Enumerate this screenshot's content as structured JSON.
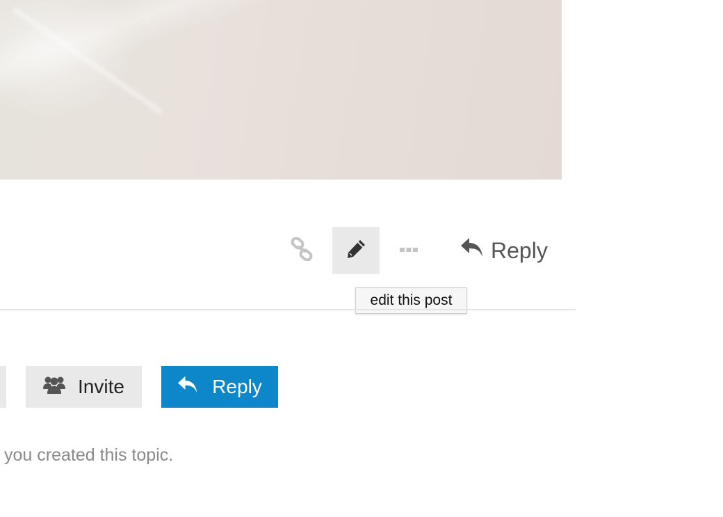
{
  "post": {
    "actions": {
      "link_icon": "link-icon",
      "edit_icon": "pencil-icon",
      "more_icon": "ellipsis-icon",
      "reply_label": "Reply",
      "reply_icon": "reply-arrow-icon"
    },
    "tooltip": "edit this post"
  },
  "footer": {
    "invite_label": "Invite",
    "invite_icon": "users-icon",
    "reply_label": "Reply",
    "reply_icon": "reply-arrow-icon",
    "status_text": "you created this topic."
  },
  "colors": {
    "primary": "#0d87c9",
    "button_bg": "#e9e9e9",
    "muted_text": "#8a8a8a",
    "icon_muted": "#c4c4c4",
    "icon_dark": "#333333"
  }
}
